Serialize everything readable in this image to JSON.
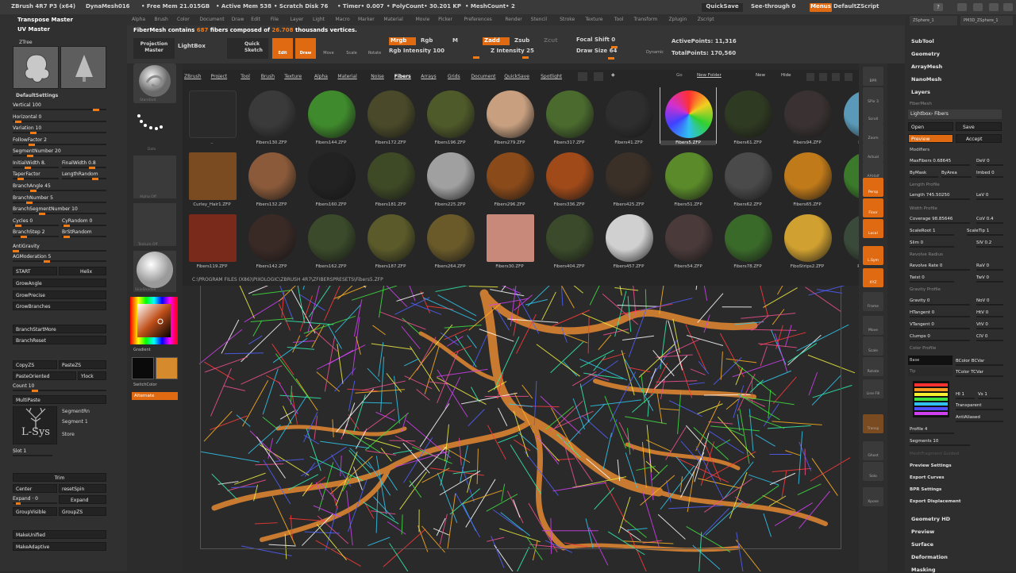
{
  "titlebar": {
    "app": "ZBrush 4R7 P3 (x64)",
    "doc": "DynaMesh016",
    "free_mem": "• Free Mem 21.015GB",
    "active_mem": "• Active Mem 538",
    "scratch": "• Scratch Disk 76",
    "timer": "• Timer• 0.007",
    "polycount": "• PolyCount• 30.201 KP",
    "meshcount": "• MeshCount• 2",
    "quicksave": "QuickSave",
    "seethrough": "See-through 0",
    "menus": "Menus",
    "script": "DefaultZScript"
  },
  "menubar": [
    "Alpha",
    "Brush",
    "Color",
    "Document",
    "Draw",
    "Edit",
    "File",
    "Layer",
    "Light",
    "Macro",
    "Marker",
    "Material",
    "Movie",
    "Picker",
    "Preferences",
    "Render",
    "Stencil",
    "Stroke",
    "Texture",
    "Tool",
    "Transform",
    "Zplugin",
    "Zscript"
  ],
  "top": {
    "fibermesh_msg": "FiberMesh contains",
    "fiber_count": "687",
    "fibers_word": "fibers composed of",
    "vert_count": "26.708",
    "vert_word": "thousands vertices.",
    "projection_master": "Projection Master",
    "lightbox": "LightBox",
    "quick_sketch": "Quick Sketch",
    "edit": "Edit",
    "draw": "Draw",
    "move": "Move",
    "scale": "Scale",
    "rotate": "Rotate",
    "mrgb": "Mrgb",
    "rgb": "Rgb",
    "m": "M",
    "zadd": "Zadd",
    "zsub": "Zsub",
    "zcut": "Zcut",
    "rgb_intensity": "Rgb Intensity 100",
    "z_intensity": "Z Intensity 25",
    "focal_shift": "Focal Shift 0",
    "draw_size": "Draw Size 64",
    "dynamic": "Dynamic",
    "active_points": "ActivePoints: 11,316",
    "total_points": "TotalPoints: 170,560"
  },
  "left": {
    "transpose_master": "Transpose Master",
    "uv_master": "UV Master",
    "ztree": "ZTree",
    "default_settings": "DefaultSettings",
    "sliders": [
      "Vertical 100",
      "Horizontal 0",
      "Variation 10",
      "FollowFactor 2",
      "SegmentNumber 20",
      "InitialWidth 8.",
      "FinalWidth 0.8",
      "TaperFactor",
      "LengthRandom",
      "BranchAngle 45",
      "BranchNumber 5",
      "BranchSegmentNumber 10",
      "Cycles 0",
      "CyRandom 0",
      "BranchStep 2",
      "BrStRandom",
      "AntiGravity",
      "AGModeration 5"
    ],
    "start": "START",
    "helix": "Helix",
    "buttons": [
      "GrowAngle",
      "GrowPrecise",
      "GrowBranches",
      "BranchStartMore",
      "BranchReset"
    ],
    "copy": "CopyZS",
    "paste": "PasteZS",
    "paste_oriented": "PasteOriented",
    "ylock": "Ylock",
    "count": "Count 10",
    "multipaste": "MultiPaste",
    "segmentrn": "SegmentRn",
    "segment": "Segment 1",
    "store": "Store",
    "lsys": "L-Sys",
    "slot": "Slot 1",
    "trim": "Trim",
    "center": "Center",
    "resetspin": "resetSpin",
    "expand0": "Expand · 0",
    "expand": "Expand",
    "groupvisible": "GroupVisible",
    "groupzs": "GroupZS",
    "makeunified": "MakeUnified",
    "makeadaptive": "MakeAdaptive"
  },
  "midtools": {
    "standard": "Standard",
    "dots": "Dots",
    "alpha_off": "Alpha Off",
    "texture_off": "Texture Off",
    "matcap": "SkinShade4",
    "gradient": "Gradient",
    "switchcolor": "SwitchColor",
    "alternate": "Alternate"
  },
  "lightbox": {
    "tabs": [
      "ZBrush",
      "Project",
      "Tool",
      "Brush",
      "Texture",
      "Alpha",
      "Material",
      "Noise",
      "Fibers",
      "Arrays",
      "Grids",
      "Document",
      "QuickSave",
      "Spotlight"
    ],
    "active_tab": "Fibers",
    "go": "Go",
    "new_folder": "New Folder",
    "new": "New",
    "hide": "Hide",
    "path": "C:\\PROGRAM FILES (X86)\\PIXOLOGIC\\ZBRUSH 4R7\\ZFIBERSPRESETS\\Fibers5.ZFP",
    "tiles": [
      {
        "name": "..",
        "color": "#2c2c2c"
      },
      {
        "name": "Fibers130.ZFP",
        "color": "#3a3a3a"
      },
      {
        "name": "Fibers144.ZFP",
        "color": "#3f8a2c"
      },
      {
        "name": "Fibers172.ZFP",
        "color": "#4a4a2a"
      },
      {
        "name": "Fibers196.ZFP",
        "color": "#4f5a2a"
      },
      {
        "name": "Fibers279.ZFP",
        "color": "#c8a080"
      },
      {
        "name": "Fibers317.ZFP",
        "color": "#4a6a2e"
      },
      {
        "name": "Fibers41.ZFP",
        "color": "#2e2e2e"
      },
      {
        "name": "Fibers5.ZFP",
        "color": "#4a6ab0"
      },
      {
        "name": "Fibers61.ZFP",
        "color": "#2f3a22"
      },
      {
        "name": "Fibers94.ZFP",
        "color": "#3a3232"
      },
      {
        "name": "Fibers...",
        "color": "#5a9ab8"
      },
      {
        "name": "Curley_Hair1.ZFP",
        "color": "#7a4a20"
      },
      {
        "name": "Fibers132.ZFP",
        "color": "#8a5a3a"
      },
      {
        "name": "Fibers160.ZFP",
        "color": "#222222"
      },
      {
        "name": "Fibers181.ZFP",
        "color": "#3e4a26"
      },
      {
        "name": "Fibers225.ZFP",
        "color": "#a0a0a0"
      },
      {
        "name": "Fibers296.ZFP",
        "color": "#8a4a1a"
      },
      {
        "name": "Fibers336.ZFP",
        "color": "#a04a1a"
      },
      {
        "name": "Fibers425.ZFP",
        "color": "#3a3028"
      },
      {
        "name": "Fibers51.ZFP",
        "color": "#5a8a2a"
      },
      {
        "name": "Fibers62.ZFP",
        "color": "#4a4a4a"
      },
      {
        "name": "Fibers65.ZFP",
        "color": "#c07a1a"
      },
      {
        "name": "Fi...",
        "color": "#3a7a2a"
      },
      {
        "name": "Fibers119.ZFP",
        "color": "#7a2a1a"
      },
      {
        "name": "Fibers142.ZFP",
        "color": "#3a2a26"
      },
      {
        "name": "Fibers162.ZFP",
        "color": "#3a4a2a"
      },
      {
        "name": "Fibers187.ZFP",
        "color": "#5a5a2a"
      },
      {
        "name": "Fibers264.ZFP",
        "color": "#6a5a2a"
      },
      {
        "name": "Fibers30.ZFP",
        "color": "#c8887a"
      },
      {
        "name": "Fibers404.ZFP",
        "color": "#3a4a2a"
      },
      {
        "name": "Fibers457.ZFP",
        "color": "#d0d0d0"
      },
      {
        "name": "Fibers54.ZFP",
        "color": "#4a3a3a"
      },
      {
        "name": "Fibers78.ZFP",
        "color": "#3a6a2a"
      },
      {
        "name": "FiboStrips2.ZFP",
        "color": "#d0a030"
      },
      {
        "name": "Pod_St...",
        "color": "#3a4a3a"
      }
    ]
  },
  "dock": [
    "BPR",
    "SPix 3",
    "Scroll",
    "Zoom",
    "Actual",
    "AAHalf",
    "Persp",
    "Floor",
    "Local",
    "L.Sym",
    "XYZ",
    "Frame",
    "Move",
    "Scale",
    "Rotate",
    "Line Fill",
    "Transp",
    "Ghost",
    "Solo",
    "Xpose"
  ],
  "right": {
    "subtool": "SubTool",
    "geometry": "Geometry",
    "arraymesh": "ArrayMesh",
    "nanomesh": "NanoMesh",
    "layers": "Layers",
    "fibermesh": "FiberMesh",
    "lightbox_fibers": "Lightbox› Fibers",
    "open": "Open",
    "save": "Save",
    "preview": "Preview",
    "accept": "Accept",
    "modifiers": "Modifiers",
    "maxfibers": "MaxFibers 0.68645",
    "dev": "DeV 0",
    "bymask": "ByMask",
    "byarea": "ByArea",
    "imbed": "Imbed 0",
    "length_profile": "Length Profile",
    "length": "Length 745.50250",
    "lev": "LeV 0",
    "width_profile": "Width Profile",
    "coverage": "Coverage 98.85646",
    "cov": "CoV 0.4",
    "scaleroot": "ScaleRoot 1",
    "scaletip": "ScaleTip 1",
    "slim": "Slim 0",
    "siv": "SlV 0.2",
    "revolve_radius": "Revolve Radius",
    "revolve_rate": "Revolve Rate 0",
    "rav": "RaV 0",
    "twist": "Twist 0",
    "tav": "TwV 0",
    "gravity_profile": "Gravity Profile",
    "gravity": "Gravity 0",
    "nov": "NoV 0",
    "hangent": "HTangent 0",
    "htv": "HtV 0",
    "vtangent": "VTangent 0",
    "vtv": "VtV 0",
    "clumps": "Clumps 0",
    "clv": "ClV 0",
    "color_profile": "Color Profile",
    "base": "Base",
    "tip": "Tip",
    "bcolor": "BColor BCVar",
    "tcolor": "TColor TCVar",
    "hs": "HI 1",
    "vs": "Vs 1",
    "transparent": "Transparent",
    "antialiased": "AntiAliased",
    "profile": "Profile 4",
    "segments": "Segments 10",
    "meshfragment": "MeshFragment Guided",
    "preview_settings": "Preview Settings",
    "export_curves": "Export Curves",
    "bpr_settings": "BPR Settings",
    "export_displacement": "Export Displacement",
    "geometry_hd": "Geometry HD",
    "preview2": "Preview",
    "surface": "Surface",
    "deformation": "Deformation",
    "masking": "Masking",
    "tabs": [
      "ZSphere_1",
      "PM3D_ZSphere_1"
    ]
  }
}
